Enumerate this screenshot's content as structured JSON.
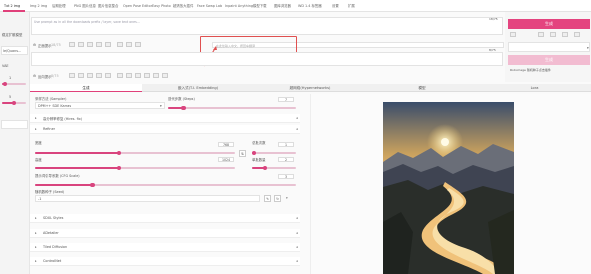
{
  "tabs": [
    "Txt 2 img",
    "Img 2 img",
    "后期处理",
    "PNG 图片信息",
    "图片信息整合",
    "Open Pose Editor",
    "Easy Photo",
    "超清放大插件",
    "Face Swap Lab",
    "Inpaint Anything",
    "模型下载",
    "图库浏览器",
    "WD 1.4 标签器",
    "设置",
    "扩展"
  ],
  "active_tab_index": 0,
  "left": {
    "model_label": "稳定扩散模型",
    "model_value": "le/Quans...",
    "vae_label": "VAE",
    "val1": "1",
    "val2": "5"
  },
  "prompt": {
    "placeholder": "Use prompt as in all the downloads prefix / layer, save text ones...",
    "counter": "18/75"
  },
  "neg_counter": "8/75",
  "toolbar1": {
    "label": "正面提示",
    "counter": "18/75"
  },
  "translate": {
    "placeholder": "在此处输入中文，按回车翻译"
  },
  "toolbar2": {
    "label": "反向提示",
    "counter": "8/75"
  },
  "right": {
    "generate_label": "生成",
    "interrupt_label": "",
    "style_label": "生成",
    "extra_label": "Roll-image 随机种子点击插件"
  },
  "subtabs": [
    "生成",
    "嵌入式(T.I. Embedding)",
    "超网络(Hypernetworks)",
    "模型",
    "Lora"
  ],
  "sampler": {
    "label": "采样方法 (Sampler)",
    "value": "DPM++ SDE Karras",
    "steps_label": "迭代步数 (Steps)",
    "steps": "7"
  },
  "sections": {
    "hires": "高分辨率修复 (Hires. fix)",
    "refiner": "Refiner",
    "self_styles": "SDXL Styles",
    "adetailer": "ADetailer",
    "tiled": "Tiled Diffusion",
    "controlnet": "ControlNet"
  },
  "size": {
    "width_label": "宽度",
    "width": "768",
    "height_label": "高度",
    "height": "1024",
    "batch_count_label": "总批次数",
    "batch_count": "1",
    "batch_size_label": "单批数量",
    "batch_size": "2"
  },
  "cfg": {
    "label": "提示词引导系数 (CFG Scale)",
    "value": "3"
  },
  "seed": {
    "label": "随机数种子 (Seed)",
    "value": "-1"
  },
  "slider_levels": {
    "steps": 0.12,
    "width": 0.42,
    "height": 0.42,
    "batch_count": 0.05,
    "batch_size": 0.3,
    "cfg": 0.22
  }
}
